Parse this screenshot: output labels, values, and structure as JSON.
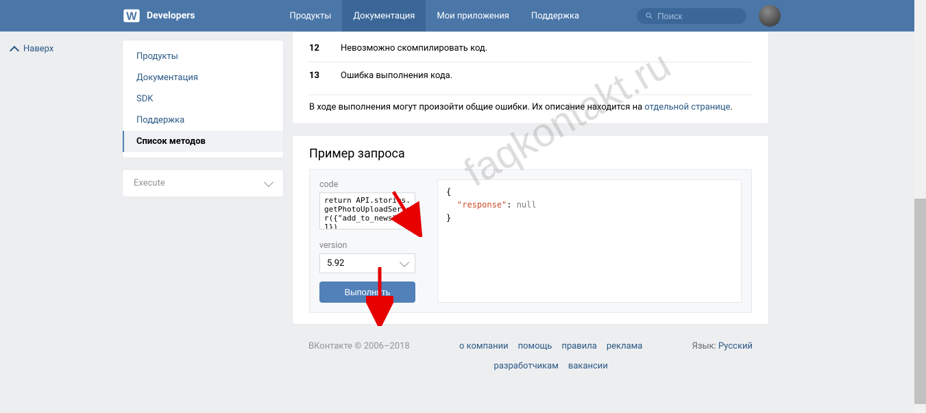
{
  "header": {
    "brand": "Developers",
    "nav": {
      "products": "Продукты",
      "docs": "Документация",
      "apps": "Мои приложения",
      "support": "Поддержка"
    },
    "search_placeholder": "Поиск"
  },
  "leftpane": {
    "back": "Наверх"
  },
  "sidebar": {
    "items": [
      {
        "label": "Продукты"
      },
      {
        "label": "Документация"
      },
      {
        "label": "SDK"
      },
      {
        "label": "Поддержка"
      },
      {
        "label": "Список методов"
      }
    ],
    "execute": "Execute"
  },
  "errors": {
    "row1": {
      "num": "12",
      "text": "Невозможно скомпилировать код."
    },
    "row2": {
      "num": "13",
      "text": "Ошибка выполнения кода."
    },
    "note_prefix": "В ходе выполнения могут произойти общие ошибки. Их описание находится на ",
    "note_link": "отдельной странице",
    "note_suffix": "."
  },
  "example": {
    "title": "Пример запроса",
    "code_label": "code",
    "code_value": "return API.stories.getPhotoUploadServer({\"add_to_news\":1})",
    "version_label": "version",
    "version_value": "5.92",
    "execute_btn": "Выполнить",
    "result": {
      "brace_open": "{",
      "key": "\"response\"",
      "colon": ": ",
      "value": "null",
      "brace_close": "}"
    }
  },
  "footer": {
    "copyright": "ВКонтакте © 2006–2018",
    "links": {
      "about": "о компании",
      "help": "помощь",
      "rules": "правила",
      "ads": "реклама",
      "devs": "разработчикам",
      "jobs": "вакансии"
    },
    "lang_label": "Язык: ",
    "lang_value": "Русский"
  },
  "watermark": "faqkontakt.ru"
}
